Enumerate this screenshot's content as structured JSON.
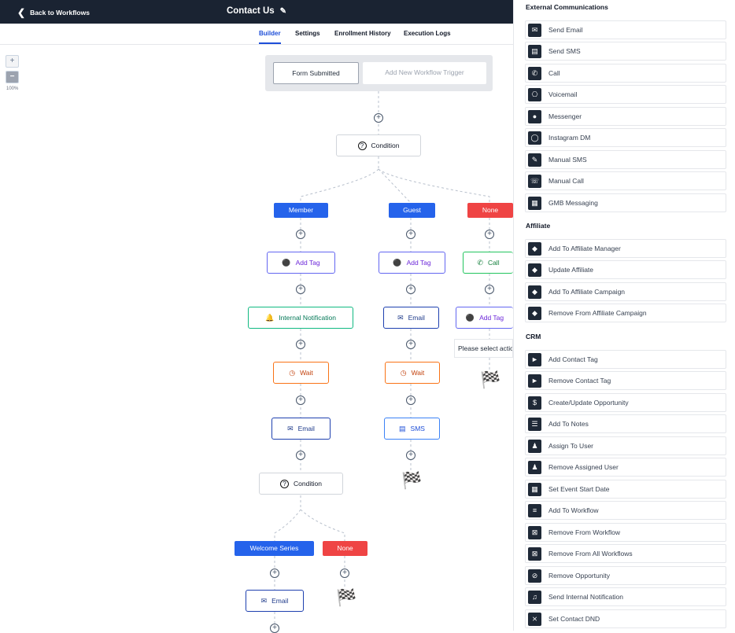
{
  "topbar": {
    "back_label": "Back to Workflows",
    "title": "Contact Us"
  },
  "tabs": [
    "Builder",
    "Settings",
    "Enrollment History",
    "Execution Logs"
  ],
  "zoom": {
    "plus": "+",
    "minus": "−",
    "level": "100%"
  },
  "trigger": {
    "form_submitted": "Form Submitted",
    "add_trigger": "Add New Workflow Trigger"
  },
  "canvas": {
    "condition1": "Condition",
    "branches": {
      "member": "Member",
      "guest": "Guest",
      "none": "None"
    },
    "member": {
      "add_tag": "Add Tag",
      "notification": "Internal Notification",
      "wait": "Wait",
      "email": "Email"
    },
    "guest": {
      "add_tag": "Add Tag",
      "email": "Email",
      "wait": "Wait",
      "sms": "SMS"
    },
    "none": {
      "call": "Call",
      "add_tag": "Add Tag",
      "select_action": "Please select action"
    },
    "condition2": "Condition",
    "branches2": {
      "welcome": "Welcome Series",
      "none": "None"
    },
    "welcome": {
      "email": "Email"
    },
    "colors": {
      "branch_blue": "#2563eb",
      "branch_red": "#ef4444",
      "topbar": "#1a2332"
    }
  },
  "panel": {
    "sections": [
      {
        "title": "External Communications",
        "items": [
          {
            "label": "Send Email",
            "icon": "envelope-icon"
          },
          {
            "label": "Send SMS",
            "icon": "chat-icon"
          },
          {
            "label": "Call",
            "icon": "phone-icon"
          },
          {
            "label": "Voicemail",
            "icon": "voicemail-icon"
          },
          {
            "label": "Messenger",
            "icon": "messenger-icon"
          },
          {
            "label": "Instagram DM",
            "icon": "instagram-icon"
          },
          {
            "label": "Manual SMS",
            "icon": "manual-sms-icon"
          },
          {
            "label": "Manual Call",
            "icon": "manual-call-icon"
          },
          {
            "label": "GMB Messaging",
            "icon": "store-icon"
          }
        ]
      },
      {
        "title": "Affiliate",
        "items": [
          {
            "label": "Add To Affiliate Manager",
            "icon": "diamond-icon"
          },
          {
            "label": "Update Affiliate",
            "icon": "diamond-icon"
          },
          {
            "label": "Add To Affiliate Campaign",
            "icon": "diamond-icon"
          },
          {
            "label": "Remove From Affiliate Campaign",
            "icon": "diamond-icon"
          }
        ]
      },
      {
        "title": "CRM",
        "items": [
          {
            "label": "Add Contact Tag",
            "icon": "tag-icon"
          },
          {
            "label": "Remove Contact Tag",
            "icon": "tag-remove-icon"
          },
          {
            "label": "Create/Update Opportunity",
            "icon": "dollar-icon"
          },
          {
            "label": "Add To Notes",
            "icon": "note-icon"
          },
          {
            "label": "Assign To User",
            "icon": "user-icon"
          },
          {
            "label": "Remove Assigned User",
            "icon": "user-remove-icon"
          },
          {
            "label": "Set Event Start Date",
            "icon": "calendar-icon"
          },
          {
            "label": "Add To Workflow",
            "icon": "list-add-icon"
          },
          {
            "label": "Remove From Workflow",
            "icon": "list-remove-icon"
          },
          {
            "label": "Remove From All Workflows",
            "icon": "list-remove-all-icon"
          },
          {
            "label": "Remove Opportunity",
            "icon": "funnel-off-icon"
          },
          {
            "label": "Send Internal Notification",
            "icon": "bell-icon"
          },
          {
            "label": "Set Contact DND",
            "icon": "bell-off-icon"
          }
        ]
      }
    ]
  }
}
